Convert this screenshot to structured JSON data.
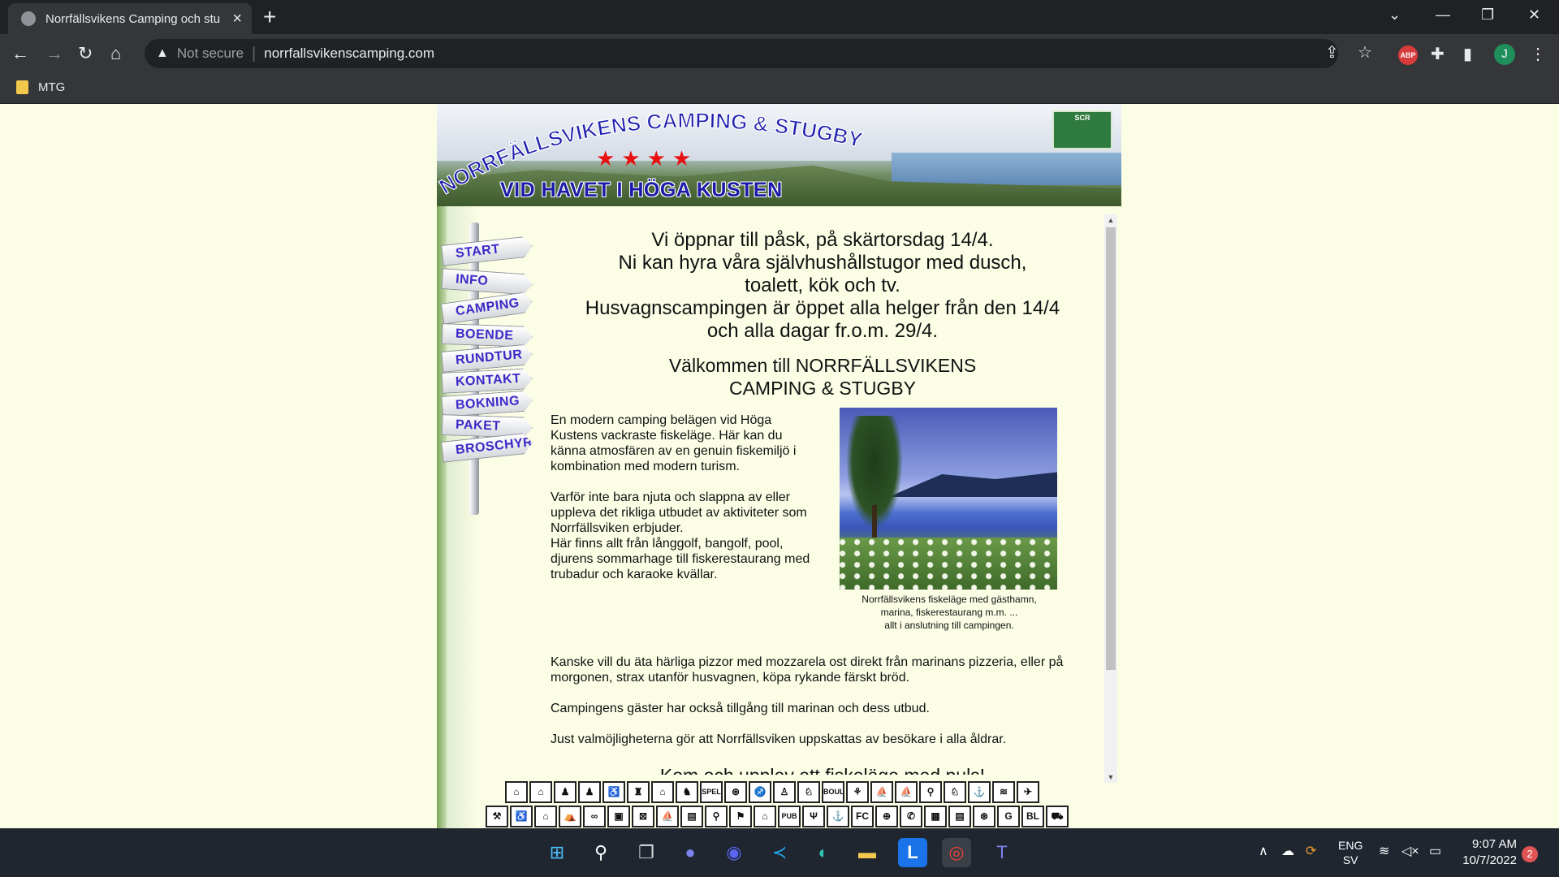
{
  "browser": {
    "tab_title": "Norrfällsvikens Camping och stu",
    "new_tab_label": "+",
    "not_secure": "Not secure",
    "url": "norrfallsvikenscamping.com",
    "bookmark": "MTG",
    "avatar_initial": "J",
    "abp_label": "ABP"
  },
  "site": {
    "banner_title": "NORRFÄLLSVIKENS CAMPING & STUGBY",
    "banner_subtitle": "VID HAVET I HÖGA KUSTEN",
    "banner_stars": "★★★★",
    "scr_logo": "SCR",
    "nav": [
      "START",
      "INFO",
      "CAMPING",
      "BOENDE",
      "RUNDTUR",
      "KONTAKT",
      "BOKNING",
      "PAKET",
      "BROSCHYR"
    ],
    "announcement": [
      "Vi öppnar till påsk, på skärtorsdag 14/4.",
      "Ni kan hyra våra självhushållstugor med dusch,",
      "toalett, kök och tv.",
      "Husvagnscampingen är öppet alla helger från den 14/4",
      "och alla dagar fr.o.m. 29/4."
    ],
    "welcome": [
      "Välkommen till NORRFÄLLSVIKENS",
      "CAMPING & STUGBY"
    ],
    "intro_para_1": "En modern camping belägen vid Höga Kustens vackraste fiskeläge. Här kan du känna atmosfären av en genuin fiskemiljö i kombination med modern turism.",
    "intro_para_2": "Varför inte bara njuta och slappna av eller uppleva det rikliga utbudet av aktiviteter som Norrfällsviken erbjuder.",
    "intro_para_3": "Här finns allt från långgolf, bangolf, pool, djurens sommarhage till fiskerestaurang med trubadur och karaoke kvällar.",
    "photo_caption": [
      "Norrfällsvikens fiskeläge med gästhamn,",
      "marina, fiskerestaurang m.m. ...",
      "allt i anslutning till campingen."
    ],
    "para_pizza": "Kanske vill du äta härliga pizzor med mozzarela ost direkt från marinans pizzeria, eller på morgonen, strax utanför husvagnen, köpa rykande färskt bröd.",
    "para_marina": "Campingens gäster har också tillgång till marinan och dess utbud.",
    "para_choices": "Just valmöjligheterna gör att Norrfällsviken uppskattas av besökare i alla åldrar.",
    "cutoff_heading": "Kom och upplev ett fiskeläge med puls!",
    "icon_row_1": [
      "⌂",
      "⌂",
      "♟",
      "♟",
      "♿",
      "♜",
      "⌂",
      "♞",
      "SPEL",
      "⊛",
      "♐",
      "♙",
      "♘",
      "BOULE",
      "⚘",
      "⛵",
      "⛵",
      "⚲",
      "♘",
      "⚓",
      "≋",
      "✈"
    ],
    "icon_row_2": [
      "⚒",
      "♿",
      "⌂",
      "⛺",
      "∞",
      "▣",
      "⊠",
      "⛵",
      "▤",
      "⚲",
      "⚑",
      "⌂",
      "PUB",
      "Ψ",
      "⚓",
      "FC",
      "⊕",
      "✆",
      "▦",
      "▤",
      "⊛",
      "G",
      "BL",
      "⛟"
    ]
  },
  "taskbar": {
    "lang_1": "ENG",
    "lang_2": "SV",
    "time": "9:07 AM",
    "date": "10/7/2022",
    "notifications": "2"
  }
}
